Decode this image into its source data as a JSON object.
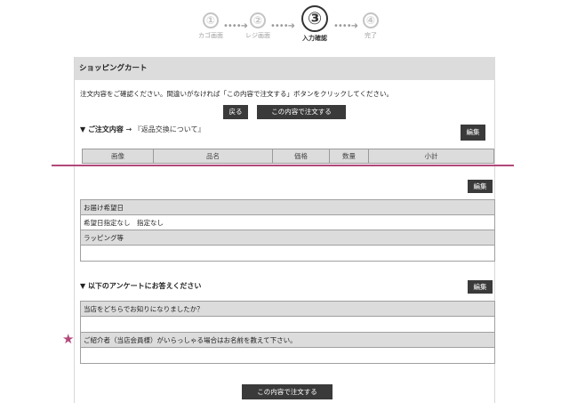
{
  "steps": [
    {
      "number": "①",
      "label": "カゴ画面"
    },
    {
      "number": "②",
      "label": "レジ画面"
    },
    {
      "number": "③",
      "label": "入力確認"
    },
    {
      "number": "④",
      "label": "完了"
    }
  ],
  "arrow": "••••➜",
  "cart": {
    "title": "ショッピングカート",
    "instruction": "注文内容をご確認ください。間違いがなければ「この内容で注文する」ボタンをクリックしてください。",
    "back_button": "戻る",
    "order_button": "この内容で注文する",
    "order_section_title": "▼ ご注文内容",
    "order_section_arrow": "→",
    "returns_link": "『返品交換について』",
    "edit_button": "編集",
    "columns": [
      "画像",
      "品名",
      "価格",
      "数量",
      "小計"
    ]
  },
  "delivery": {
    "edit_button": "編集",
    "date_label": "お届け希望日",
    "date_value": "希望日指定なし　指定なし",
    "wrapping_label": "ラッピング等",
    "wrapping_value": ""
  },
  "survey": {
    "title": "▼ 以下のアンケートにお答えください",
    "edit_button": "編集",
    "q1": "当店をどちらでお知りになりましたか？",
    "a1": "",
    "q2": "ご紹介者（当店会員様）がいらっしゃる場合はお名前を教えて下さい。",
    "a2": ""
  },
  "star": "★",
  "bottom_order_button": "この内容で注文する",
  "colors": {
    "accent": "#b2487a",
    "button": "#3a3a3a",
    "header_bg": "#dcdcdc"
  }
}
